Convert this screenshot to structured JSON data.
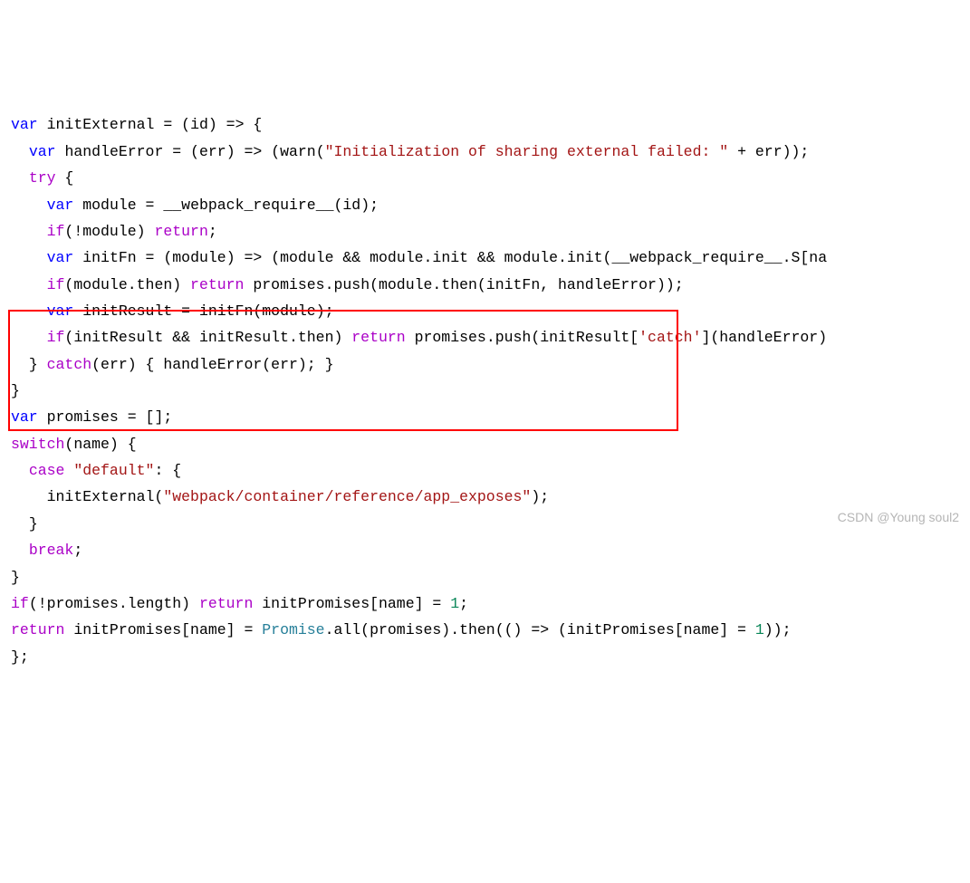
{
  "code": {
    "l1": {
      "var": "var",
      "name": "initExternal",
      "op": " = (",
      "p1": "id",
      "tail": ") => {"
    },
    "l2": {
      "var": "var",
      "name": "handleError",
      "op": " = (",
      "p1": "err",
      "mid": ") => (warn(",
      "s": "\"Initialization of sharing external failed: \"",
      "tail": " + err));"
    },
    "l3": {
      "try": "try",
      "tail": " {"
    },
    "l4": {
      "var": "var",
      "name": "module",
      "eq": " = __webpack_require__(id);"
    },
    "l5": {
      "if": "if",
      "cond": "(!module) ",
      "ret": "return",
      "tail": ";"
    },
    "l6": {
      "var": "var",
      "name": "initFn",
      "op": " = (",
      "p1": "module",
      "mid": ") => (module && module.init && module.init(__webpack_require__.S[na"
    },
    "l7": {
      "if": "if",
      "cond": "(module.then) ",
      "ret": "return",
      "tail": " promises.push(module.then(initFn, handleError));"
    },
    "l8": {
      "var": "var",
      "name": "initResult",
      "eq": " = initFn(module);"
    },
    "l9": {
      "if": "if",
      "cond": "(initResult && initResult.then) ",
      "ret": "return",
      "mid": " promises.push(initResult[",
      "s": "'catch'",
      "tail": "](handleError)"
    },
    "l10": {
      "close": "} ",
      "catch": "catch",
      "args": "(err) { handleError(err); }"
    },
    "l11": {
      "brace": "}"
    },
    "l12": {
      "var": "var",
      "name": "promises",
      "eq": " = [];"
    },
    "l13": {
      "switch": "switch",
      "args": "(name) {"
    },
    "l14": {
      "case": "case",
      "sp": " ",
      "s": "\"default\"",
      "tail": ": {"
    },
    "l15": {
      "call": "initExternal(",
      "s": "\"webpack/container/reference/app_exposes\"",
      "tail": ");"
    },
    "l16": {
      "brace": "}"
    },
    "l17": {
      "break": "break",
      "tail": ";"
    },
    "l18": {
      "brace": "}"
    },
    "l19": {
      "if": "if",
      "cond": "(!promises.length) ",
      "ret": "return",
      "tail": " initPromises[name] = ",
      "num": "1",
      "end": ";"
    },
    "l20": {
      "ret": "return",
      "a": " initPromises[name] = ",
      "prom": "Promise",
      "b": ".all(promises).then(() => (initPromises[name] = ",
      "num": "1",
      "end": "));"
    },
    "l21": {
      "tail": "};"
    }
  },
  "watermark": "CSDN @Young soul2"
}
